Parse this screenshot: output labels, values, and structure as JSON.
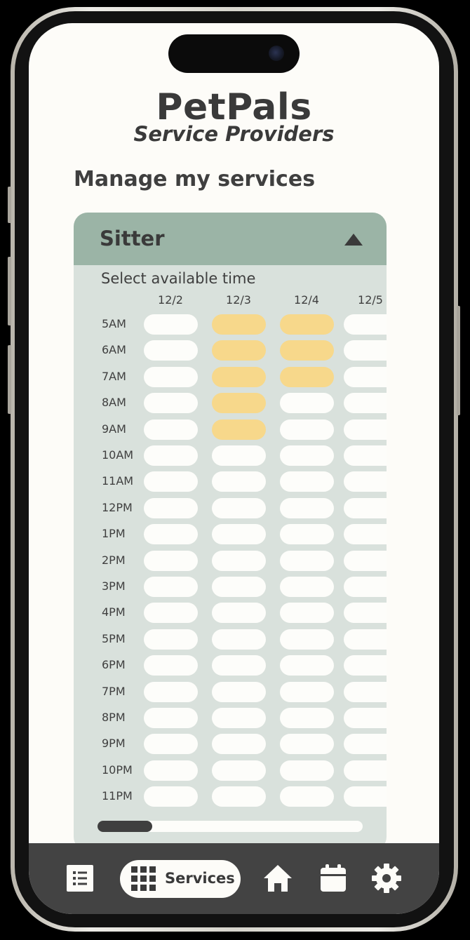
{
  "app": {
    "title": "PetPals",
    "subtitle": "Service Providers"
  },
  "page": {
    "heading": "Manage my services"
  },
  "service_card": {
    "title": "Sitter",
    "expanded": true,
    "prompt": "Select available time",
    "dates": [
      "12/2",
      "12/3",
      "12/4",
      "12/5"
    ],
    "times": [
      "5AM",
      "6AM",
      "7AM",
      "8AM",
      "9AM",
      "10AM",
      "11AM",
      "12PM",
      "1PM",
      "2PM",
      "3PM",
      "4PM",
      "5PM",
      "6PM",
      "7PM",
      "8PM",
      "9PM",
      "10PM",
      "11PM"
    ],
    "selected": [
      {
        "date": "12/3",
        "times": [
          "5AM",
          "6AM",
          "7AM",
          "8AM",
          "9AM"
        ]
      },
      {
        "date": "12/4",
        "times": [
          "5AM",
          "6AM",
          "7AM"
        ]
      }
    ],
    "colors": {
      "header": "#9bb4a6",
      "body": "#d9e1dc",
      "selected": "#f7d88b",
      "available": "#fdfdfa"
    }
  },
  "navbar": {
    "items": [
      {
        "name": "list-icon"
      },
      {
        "name": "grid-icon",
        "label": "Services",
        "active": true
      },
      {
        "name": "home-icon"
      },
      {
        "name": "calendar-icon"
      },
      {
        "name": "gear-icon"
      }
    ]
  }
}
